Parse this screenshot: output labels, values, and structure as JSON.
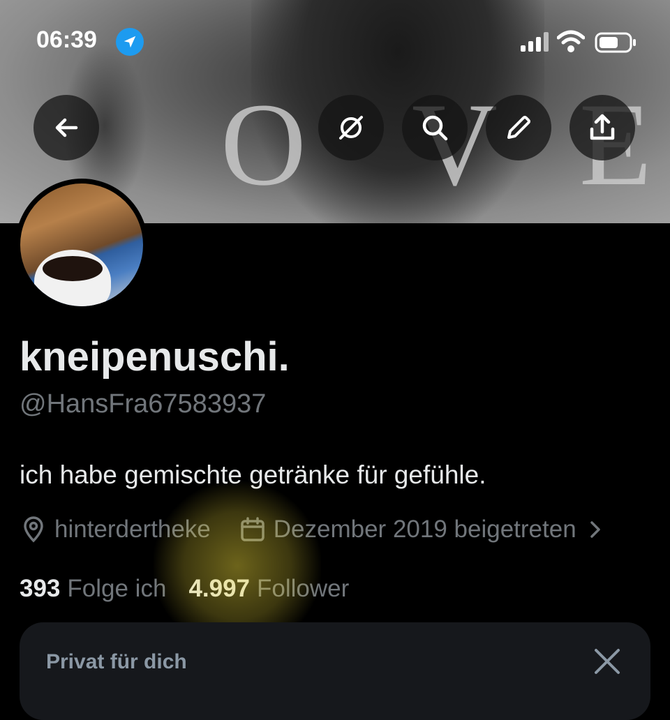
{
  "status_bar": {
    "time": "06:39",
    "location_icon": "location-arrow-icon",
    "signal_icon": "cellular-signal-icon",
    "wifi_icon": "wifi-icon",
    "battery_icon": "battery-icon"
  },
  "banner": {
    "letters": [
      "O",
      "V",
      "E"
    ],
    "actions": [
      "back-arrow-icon",
      "grok-icon",
      "search-icon",
      "edit-pencil-icon",
      "share-icon"
    ]
  },
  "profile": {
    "display_name": "kneipenuschi.",
    "handle": "@HansFra67583937",
    "bio": "ich habe gemischte getränke für gefühle.",
    "location": "hinterdertheke",
    "joined": "Dezember 2019 beigetreten",
    "following_count": "393",
    "following_label": "Folge ich",
    "followers_count": "4.997",
    "followers_label": "Follower"
  },
  "card": {
    "title": "Privat für dich"
  },
  "colors": {
    "background": "#000000",
    "text_primary": "#e7e9ea",
    "text_secondary": "#71767b",
    "accent_blue": "#1d9bf0",
    "card_bg": "#16181c"
  }
}
